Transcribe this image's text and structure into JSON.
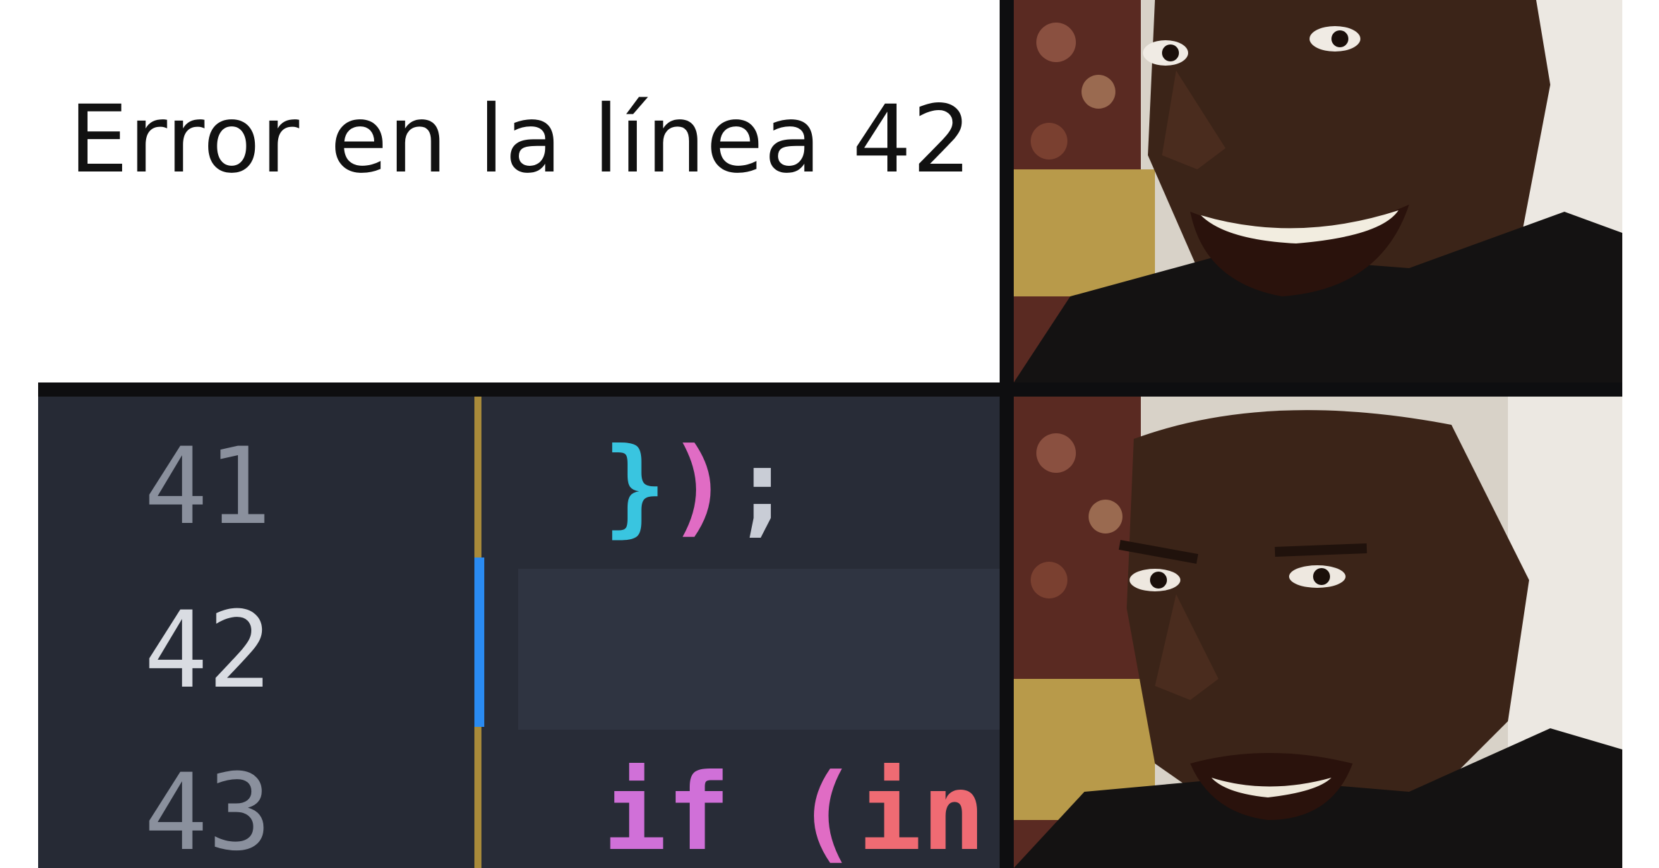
{
  "caption": {
    "text": "Error en la línea 42"
  },
  "editor": {
    "lines": [
      {
        "number": "41",
        "tokens": [
          {
            "text": "}",
            "color": "#39c5e0"
          },
          {
            "text": ")",
            "color": "#e06cc4"
          },
          {
            "text": ";",
            "color": "#c9cdd6"
          }
        ]
      },
      {
        "number": "42",
        "tokens": []
      },
      {
        "number": "43",
        "tokens": [
          {
            "text": "if",
            "color": "#d070d8"
          },
          {
            "text": " ",
            "color": "#c9cdd6"
          },
          {
            "text": "(",
            "color": "#e06cc4"
          },
          {
            "text": "in",
            "color": "#ef6b73"
          }
        ]
      }
    ],
    "active_line": "42",
    "colors": {
      "background": "#282c37",
      "guide": "#a88a3a",
      "active_marker": "#2a8bf2"
    }
  },
  "reactions": {
    "top": {
      "icon": "smiling-man-photo"
    },
    "bottom": {
      "icon": "disappointed-man-photo"
    }
  }
}
